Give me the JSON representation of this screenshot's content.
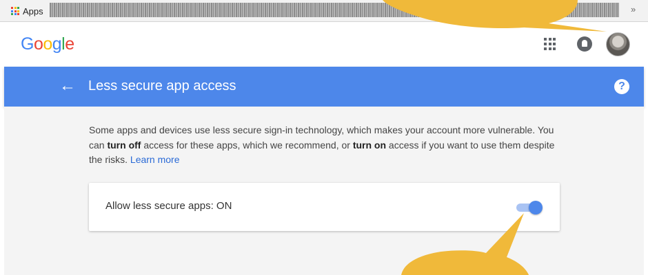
{
  "bookmarks_bar": {
    "apps_label": "Apps",
    "overflow_label": "»"
  },
  "header": {
    "logo_letters": [
      "G",
      "o",
      "o",
      "g",
      "l",
      "e"
    ],
    "logo_colors": [
      "#4285f4",
      "#ea4335",
      "#fbbc05",
      "#4285f4",
      "#34a853",
      "#ea4335"
    ]
  },
  "titlebar": {
    "back_glyph": "←",
    "title": "Less secure app access",
    "help_glyph": "?"
  },
  "content": {
    "desc_part1": "Some apps and devices use less secure sign-in technology, which makes your account more vulnerable. You can ",
    "desc_bold1": "turn off",
    "desc_part2": " access for these apps, which we recommend, or ",
    "desc_bold2": "turn on",
    "desc_part3": " access if you want to use them despite the risks. ",
    "learn_more": "Learn more",
    "setting_label": "Allow less secure apps: ON",
    "toggle_state": "on"
  },
  "colors": {
    "accent_blue": "#4d87ea",
    "callout_yellow": "#f0b93a",
    "link_blue": "#2a6ad6"
  }
}
